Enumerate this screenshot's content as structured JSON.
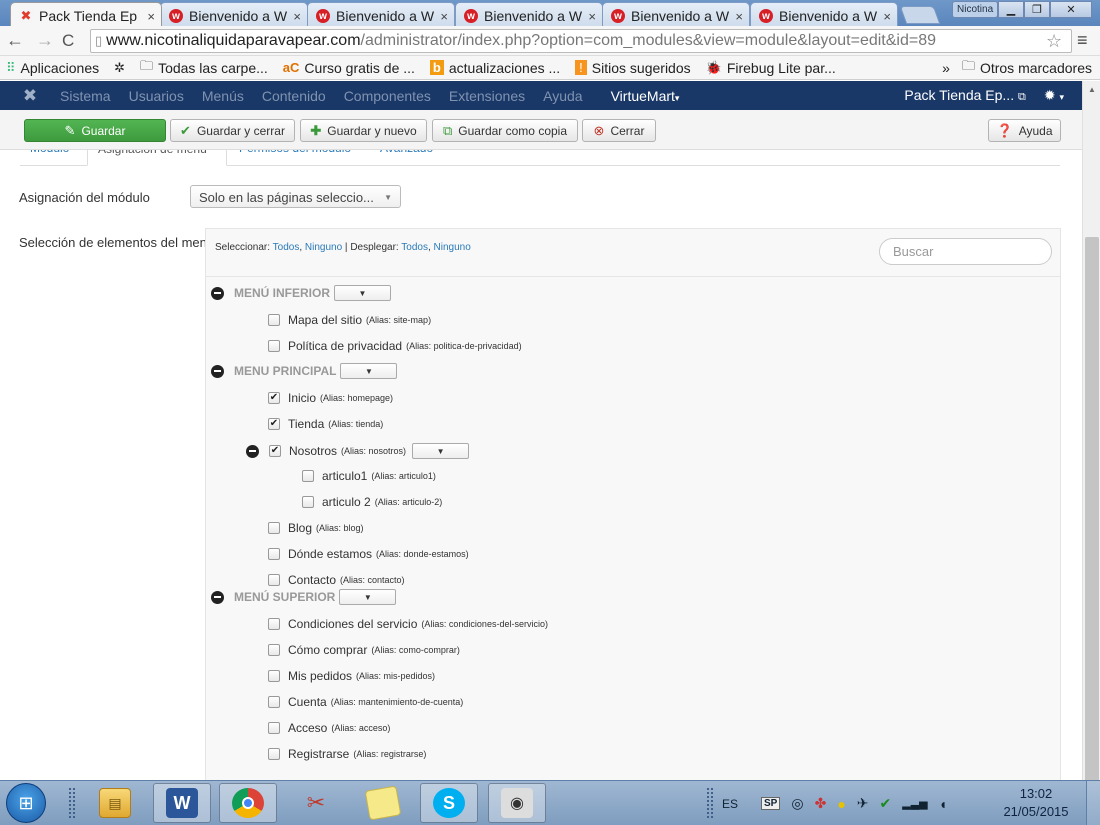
{
  "browser": {
    "tabs": [
      {
        "title": "Pack Tienda Ep",
        "icon": "joomla-icon",
        "active": true
      },
      {
        "title": "Bienvenido a W",
        "icon": "w-icon"
      },
      {
        "title": "Bienvenido a W",
        "icon": "w-icon"
      },
      {
        "title": "Bienvenido a W",
        "icon": "w-icon"
      },
      {
        "title": "Bienvenido a W",
        "icon": "w-icon"
      },
      {
        "title": "Bienvenido a W",
        "icon": "w-icon"
      }
    ],
    "tab_close": "×",
    "profile": "Nicotina",
    "url_host": "www.nicotinaliquidaparavapear.com",
    "url_path": "/administrator/index.php?option=com_modules&view=module&layout=edit&id=89",
    "bookmarks": [
      {
        "label": "Aplicaciones",
        "icon": "apps-icon"
      },
      {
        "label": "",
        "icon": "gear-icon"
      },
      {
        "label": "Todas las carpe...",
        "icon": "folder-icon"
      },
      {
        "label": "Curso gratis de ...",
        "icon": "ac-icon"
      },
      {
        "label": "actualizaciones ...",
        "icon": "b-icon"
      },
      {
        "label": "Sitios sugeridos",
        "icon": "orange-icon"
      },
      {
        "label": "Firebug Lite par...",
        "icon": "firebug-icon"
      }
    ],
    "bookmarks_more": "»",
    "other_bookmarks": "Otros marcadores"
  },
  "joomla_nav": {
    "menus": [
      "Sistema",
      "Usuarios",
      "Menús",
      "Contenido",
      "Componentes",
      "Extensiones",
      "Ayuda"
    ],
    "virtuemart": "VirtueMart",
    "site_name": "Pack Tienda Ep..."
  },
  "toolbar": {
    "save": "Guardar",
    "save_close": "Guardar y cerrar",
    "save_new": "Guardar y nuevo",
    "save_copy": "Guardar como copia",
    "close": "Cerrar",
    "help": "Ayuda"
  },
  "module_tabs": [
    "Módulo",
    "Asignación de menú",
    "Permisos del módulo",
    "Avanzado"
  ],
  "assignment": {
    "label": "Asignación del módulo",
    "selected": "Solo en las páginas seleccio...",
    "selection_label": "Selección de elementos del menú:",
    "select_label": "Seleccionar:",
    "all": "Todos",
    "none": "Ninguno",
    "expand_label": "Desplegar:",
    "search_placeholder": "Buscar"
  },
  "menus": [
    {
      "name": "MENÚ INFERIOR",
      "items": [
        {
          "label": "Mapa del sitio",
          "alias": "(Alias: site-map)",
          "checked": false,
          "level": 1
        },
        {
          "label": "Política de privacidad",
          "alias": "(Alias: politica-de-privacidad)",
          "checked": false,
          "level": 1
        }
      ]
    },
    {
      "name": "MENU PRINCIPAL",
      "items": [
        {
          "label": "Inicio",
          "alias": "(Alias: homepage)",
          "checked": true,
          "level": 1
        },
        {
          "label": "Tienda",
          "alias": "(Alias: tienda)",
          "checked": true,
          "level": 1
        },
        {
          "label": "Nosotros",
          "alias": "(Alias: nosotros)",
          "checked": true,
          "level": 1,
          "expander": true
        },
        {
          "label": "articulo1",
          "alias": "(Alias: articulo1)",
          "checked": false,
          "level": 2
        },
        {
          "label": "articulo 2",
          "alias": "(Alias: articulo-2)",
          "checked": false,
          "level": 2
        },
        {
          "label": "Blog",
          "alias": "(Alias: blog)",
          "checked": false,
          "level": 1
        },
        {
          "label": "Dónde estamos",
          "alias": "(Alias: donde-estamos)",
          "checked": false,
          "level": 1
        },
        {
          "label": "Contacto",
          "alias": "(Alias: contacto)",
          "checked": false,
          "level": 1
        }
      ]
    },
    {
      "name": "MENÚ SUPERIOR",
      "items": [
        {
          "label": "Condiciones del servicio",
          "alias": "(Alias: condiciones-del-servicio)",
          "checked": false,
          "level": 1
        },
        {
          "label": "Cómo comprar",
          "alias": "(Alias: como-comprar)",
          "checked": false,
          "level": 1
        },
        {
          "label": "Mis pedidos",
          "alias": "(Alias: mis-pedidos)",
          "checked": false,
          "level": 1
        },
        {
          "label": "Cuenta",
          "alias": "(Alias: mantenimiento-de-cuenta)",
          "checked": false,
          "level": 1
        },
        {
          "label": "Acceso",
          "alias": "(Alias: acceso)",
          "checked": false,
          "level": 1
        },
        {
          "label": "Registrarse",
          "alias": "(Alias: registrarse)",
          "checked": false,
          "level": 1
        }
      ]
    }
  ],
  "taskbar": {
    "apps": [
      "explorer-icon",
      "word-icon",
      "chrome-icon",
      "snipping-icon",
      "sticky-notes-icon",
      "skype-icon",
      "camera-icon"
    ],
    "lang": "ES",
    "sp": "SP",
    "time": "13:02",
    "date": "21/05/2015"
  },
  "colors": {
    "save_green": "#43a843",
    "joomla_nav": "#1a3867",
    "link_blue": "#2a7ab9"
  }
}
